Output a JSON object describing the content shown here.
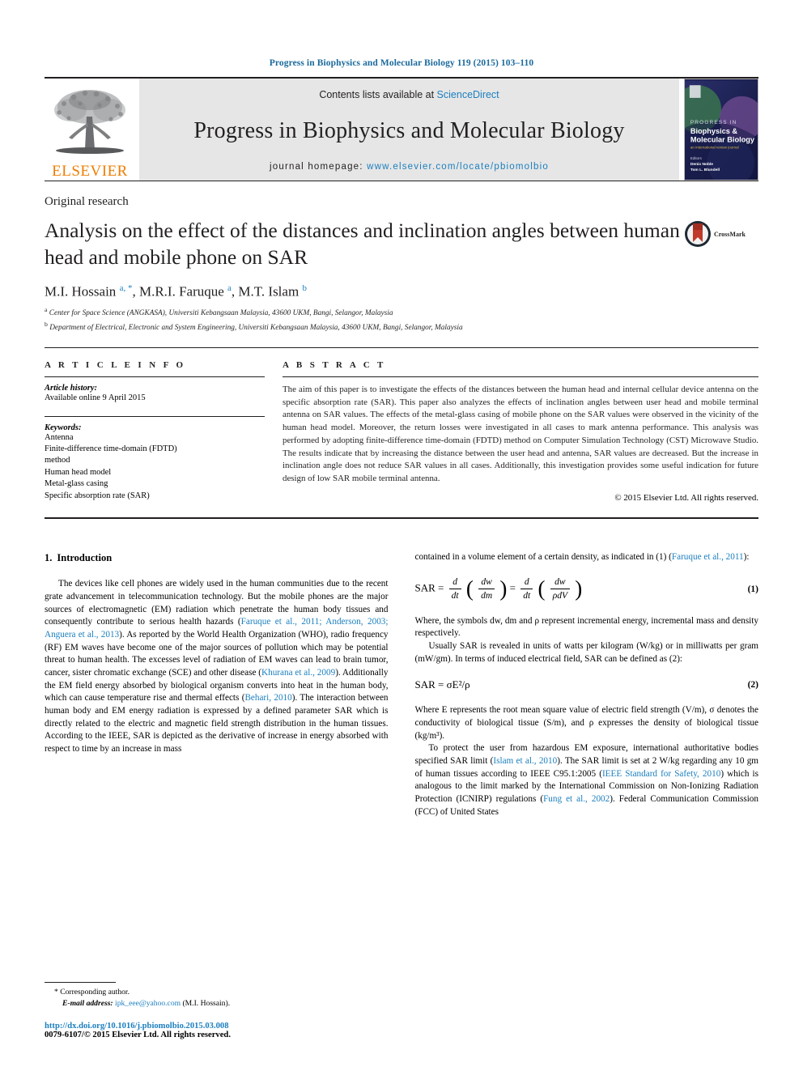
{
  "running_head": "Progress in Biophysics and Molecular Biology 119 (2015) 103–110",
  "masthead": {
    "publisher_name": "ELSEVIER",
    "contents_prefix": "Contents lists available at ",
    "contents_link": "ScienceDirect",
    "journal_name": "Progress in Biophysics and Molecular Biology",
    "homepage_prefix": "journal homepage: ",
    "homepage_url": "www.elsevier.com/locate/pbiomolbio",
    "cover": {
      "line1": "PROGRESS IN",
      "line2": "Biophysics &",
      "line3": "Molecular Biology",
      "line4": "an international review journal",
      "editors_label": "Editors",
      "editor1": "Denis Noble",
      "editor2": "Tom L. Blundell"
    }
  },
  "article": {
    "kicker": "Original research",
    "title": "Analysis on the effect of the distances and inclination angles between human head and mobile phone on SAR",
    "crossmark_label": "CrossMark",
    "authors_html": "M.I. Hossain <sup>a, *</sup>, M.R.I. Faruque <sup>a</sup>, M.T. Islam <sup>b</sup>",
    "affiliations": [
      "a Center for Space Science (ANGKASA), Universiti Kebangsaan Malaysia, 43600 UKM, Bangi, Selangor, Malaysia",
      "b Department of Electrical, Electronic and System Engineering, Universiti Kebangsaan Malaysia, 43600 UKM, Bangi, Selangor, Malaysia"
    ]
  },
  "article_info": {
    "heading": "A R T I C L E  I N F O",
    "history_label": "Article history:",
    "history_value": "Available online 9 April 2015",
    "keywords_label": "Keywords:",
    "keywords": [
      "Antenna",
      "Finite-difference time-domain (FDTD)",
      "method",
      "Human head model",
      "Metal-glass casing",
      "Specific absorption rate (SAR)"
    ]
  },
  "abstract": {
    "heading": "A B S T R A C T",
    "text": "The aim of this paper is to investigate the effects of the distances between the human head and internal cellular device antenna on the specific absorption rate (SAR). This paper also analyzes the effects of inclination angles between user head and mobile terminal antenna on SAR values. The effects of the metal-glass casing of mobile phone on the SAR values were observed in the vicinity of the human head model. Moreover, the return losses were investigated in all cases to mark antenna performance. This analysis was performed by adopting finite-difference time-domain (FDTD) method on Computer Simulation Technology (CST) Microwave Studio. The results indicate that by increasing the distance between the user head and antenna, SAR values are decreased. But the increase in inclination angle does not reduce SAR values in all cases. Additionally, this investigation provides some useful indication for future design of low SAR mobile terminal antenna.",
    "copyright": "© 2015 Elsevier Ltd. All rights reserved."
  },
  "intro": {
    "number": "1.",
    "heading": "Introduction",
    "p1_a": "The devices like cell phones are widely used in the human communities due to the recent grate advancement in telecommunication technology. But the mobile phones are the major sources of electromagnetic (EM) radiation which penetrate the human body tissues and consequently contribute to serious health hazards (",
    "p1_cite1": "Faruque et al., 2011; Anderson, 2003; Anguera et al., 2013",
    "p1_b": "). As reported by the World Health Organization (WHO), radio frequency (RF) EM waves have become one of the major sources of pollution which may be potential threat to human health. The excesses level of radiation of EM waves can lead to brain tumor, cancer, sister chromatic exchange (SCE) and other disease (",
    "p1_cite2": "Khurana et al., 2009",
    "p1_c": "). Additionally the EM field energy absorbed by biological organism converts into heat in the human body, which can cause temperature rise and thermal effects (",
    "p1_cite3": "Behari, 2010",
    "p1_d": "). The interaction between human body and EM energy radiation is expressed by a defined parameter SAR which is directly related to the electric and magnetic field strength distribution in the human tissues. According to the IEEE, SAR is depicted as the derivative of increase in energy absorbed with respect to time by an increase in mass"
  },
  "right_column": {
    "cont_a": "contained in a volume element of a certain density, as indicated in (1) (",
    "cont_cite": "Faruque et al., 2011",
    "cont_b": "):",
    "eq1": {
      "lhs": "SAR =",
      "num1": "d",
      "den1": "dt",
      "num2": "dw",
      "den2": "dm",
      "eq": "=",
      "num3": "d",
      "den3": "dt",
      "num4": "dw",
      "den4": "ρdV",
      "number": "(1)"
    },
    "p2": "Where, the symbols dw, dm and ρ represent incremental energy, incremental mass and density respectively.",
    "p3": "Usually SAR is revealed in units of watts per kilogram (W/kg) or in milliwatts per gram (mW/gm). In terms of induced electrical field, SAR can be defined as (2):",
    "eq2": {
      "text": "SAR = σE²/ρ",
      "number": "(2)"
    },
    "p4": "Where E represents the root mean square value of electric field strength (V/m), σ denotes the conductivity of biological tissue (S/m), and ρ expresses the density of biological tissue (kg/m³).",
    "p5_a": "To protect the user from hazardous EM exposure, international authoritative bodies specified SAR limit (",
    "p5_cite1": "Islam et al., 2010",
    "p5_b": "). The SAR limit is set at 2 W/kg regarding any 10 gm of human tissues according to IEEE C95.1:2005 (",
    "p5_cite2": "IEEE Standard for Safety, 2010",
    "p5_c": ") which is analogous to the limit marked by the International Commission on Non-Ionizing Radiation Protection (ICNIRP) regulations (",
    "p5_cite3": "Fung et al., 2002",
    "p5_d": "). Federal Communication Commission (FCC) of United States"
  },
  "footer": {
    "corresponding": "* Corresponding author.",
    "email_label": "E-mail address:",
    "email": "ipk_eee@yahoo.com",
    "email_owner": "(M.I. Hossain).",
    "doi": "http://dx.doi.org/10.1016/j.pbiomolbio.2015.03.008",
    "issn": "0079-6107/© 2015 Elsevier Ltd. All rights reserved."
  },
  "colors": {
    "link_blue": "#1b7fbf",
    "header_blue": "#1b6a9c",
    "elsevier_orange": "#ef7d00",
    "ink": "#231f20"
  }
}
